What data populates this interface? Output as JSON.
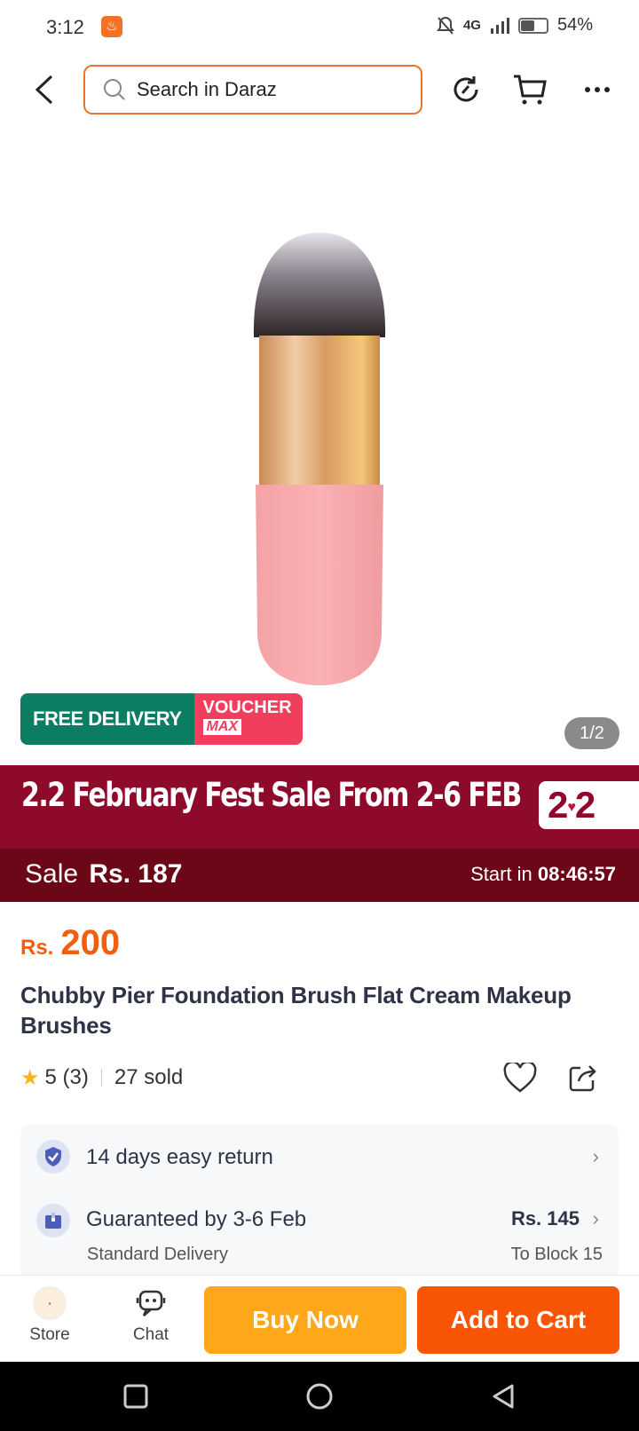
{
  "status_bar": {
    "time": "3:12",
    "network": "4G",
    "battery": "54%",
    "battery_level": 0.54
  },
  "header": {
    "search_placeholder": "Search in Daraz",
    "icons": [
      "back-icon",
      "search-icon",
      "share-refresh-icon",
      "cart-icon",
      "more-icon"
    ]
  },
  "gallery": {
    "free_delivery": "FREE DELIVERY",
    "voucher": "VOUCHER",
    "voucher_max": "MAX",
    "page_indicator": "1/2"
  },
  "campaign": {
    "title": "2.2 February Fest Sale From 2-6 FEB",
    "logo": "2.2",
    "sale_label": "Sale",
    "sale_price": "Rs. 187",
    "timer_label": "Start in",
    "timer": "08:46:57",
    "colors": {
      "banner": "#8e0a2a",
      "strip": "#6c0718"
    }
  },
  "product": {
    "currency": "Rs.",
    "price": "200",
    "title": "Chubby Pier Foundation Brush Flat Cream Makeup Brushes",
    "rating": "5",
    "rating_count": "(3)",
    "sold": "27 sold"
  },
  "info": {
    "return": "14 days easy return",
    "delivery_title": "Guaranteed by 3-6 Feb",
    "delivery_type": "Standard Delivery",
    "delivery_fee": "Rs. 145",
    "delivery_location": "To Block 15"
  },
  "bottom_bar": {
    "store_label": "Store",
    "chat_label": "Chat",
    "buy_now": "Buy Now",
    "add_to_cart": "Add to Cart",
    "colors": {
      "buy_now": "#fea71a",
      "add_to_cart": "#f85606",
      "price": "#f25d0e"
    }
  }
}
